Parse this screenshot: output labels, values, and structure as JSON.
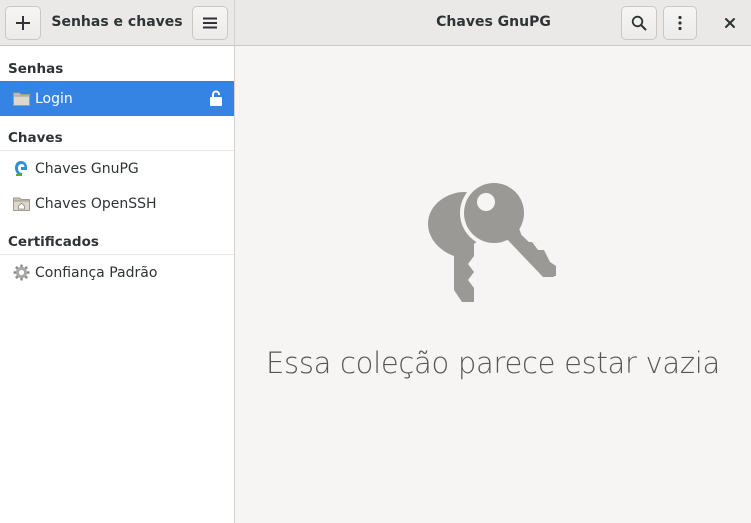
{
  "header": {
    "sidebar_title": "Senhas e chaves",
    "main_title": "Chaves GnuPG",
    "buttons": {
      "add_icon": "plus-icon",
      "menu_icon": "hamburger-menu-icon",
      "search_icon": "search-icon",
      "more_icon": "vertical-ellipsis-icon",
      "close_icon": "close-icon"
    }
  },
  "sidebar": {
    "sections": [
      {
        "title": "Senhas",
        "items": [
          {
            "label": "Login",
            "icon": "folder-icon",
            "trailing_icon": "unlock-icon",
            "selected": true
          }
        ]
      },
      {
        "title": "Chaves",
        "items": [
          {
            "label": "Chaves GnuPG",
            "icon": "gnupg-icon",
            "selected": false
          },
          {
            "label": "Chaves OpenSSH",
            "icon": "home-folder-icon",
            "selected": false
          }
        ]
      },
      {
        "title": "Certificados",
        "items": [
          {
            "label": "Confiança Padrão",
            "icon": "gear-icon",
            "selected": false
          }
        ]
      }
    ]
  },
  "main": {
    "empty_icon": "keys-icon",
    "empty_message": "Essa coleção parece estar vazia"
  },
  "colors": {
    "accent": "#3584e4",
    "headerbar": "#ebe9e7",
    "content_bg": "#f6f5f4",
    "empty_icon": "#9a9996"
  }
}
